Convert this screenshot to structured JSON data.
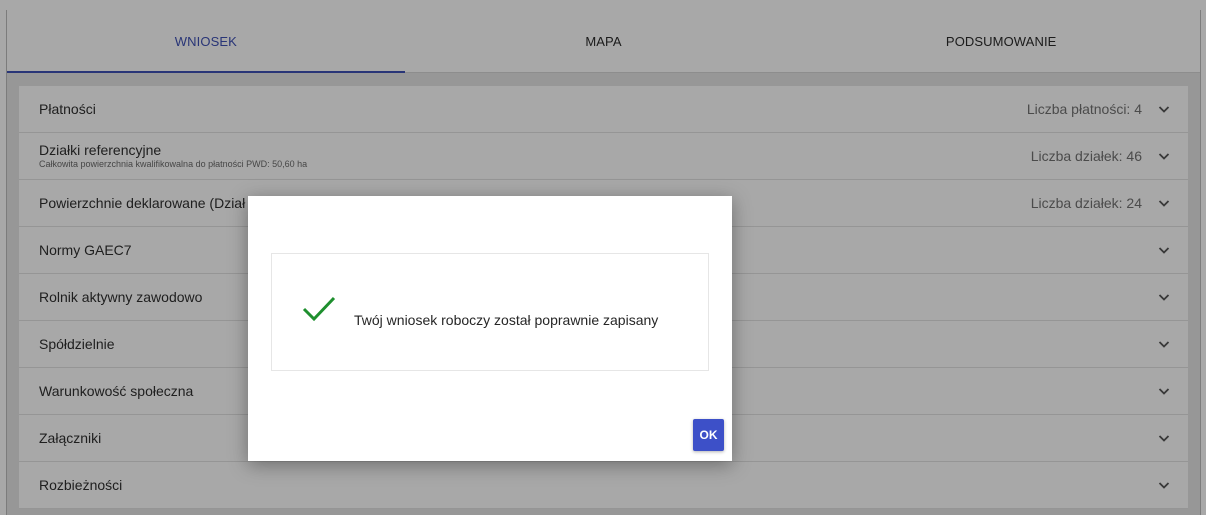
{
  "tabs": [
    {
      "label": "WNIOSEK",
      "active": true
    },
    {
      "label": "MAPA",
      "active": false
    },
    {
      "label": "PODSUMOWANIE",
      "active": false
    }
  ],
  "sections": [
    {
      "title": "Płatności",
      "subtitle": "",
      "count": "Liczba płatności: 4"
    },
    {
      "title": "Działki referencyjne",
      "subtitle": "Całkowita powierzchnia kwalifikowalna do płatności PWD: 50,60 ha",
      "count": "Liczba działek: 46"
    },
    {
      "title": "Powierzchnie deklarowane (Dział",
      "subtitle": "",
      "count": "Liczba działek: 24"
    },
    {
      "title": "Normy GAEC7",
      "subtitle": "",
      "count": ""
    },
    {
      "title": "Rolnik aktywny zawodowo",
      "subtitle": "",
      "count": ""
    },
    {
      "title": "Spółdzielnie",
      "subtitle": "",
      "count": ""
    },
    {
      "title": "Warunkowość społeczna",
      "subtitle": "",
      "count": ""
    },
    {
      "title": "Załączniki",
      "subtitle": "",
      "count": ""
    },
    {
      "title": "Rozbieżności",
      "subtitle": "",
      "count": ""
    }
  ],
  "dialog": {
    "icon": "checkmark-icon",
    "message": "Twój wniosek roboczy został poprawnie zapisany",
    "ok_label": "OK"
  },
  "colors": {
    "accent": "#3f51b5",
    "ok_button": "#3d50c8",
    "success": "#1e8f2e"
  }
}
